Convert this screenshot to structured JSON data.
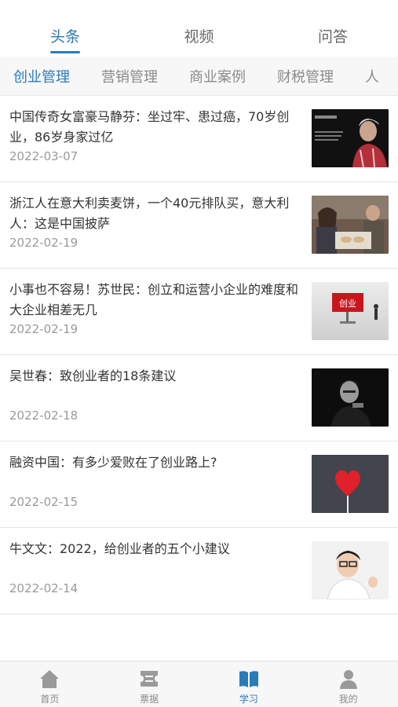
{
  "top_tabs": [
    {
      "label": "头条",
      "active": true
    },
    {
      "label": "视频",
      "active": false
    },
    {
      "label": "问答",
      "active": false
    }
  ],
  "categories": [
    {
      "label": "创业管理",
      "active": true
    },
    {
      "label": "营销管理",
      "active": false
    },
    {
      "label": "商业案例",
      "active": false
    },
    {
      "label": "财税管理",
      "active": false
    },
    {
      "label": "人",
      "active": false
    }
  ],
  "articles": [
    {
      "title": "中国传奇女富豪马静芬：坐过牢、患过癌，70岁创业，86岁身家过亿",
      "date": "2022-03-07",
      "thumb": "elderly-woman-portrait"
    },
    {
      "title": "浙江人在意大利卖麦饼，一个40元排队买，意大利人：这是中国披萨",
      "date": "2022-02-19",
      "thumb": "people-at-table"
    },
    {
      "title": "小事也不容易！苏世民：创立和运营小企业的难度和大企业相差无几",
      "date": "2022-02-19",
      "thumb": "startup-sign",
      "thumb_text": "创业"
    },
    {
      "title": "吴世春：致创业者的18条建议",
      "date": "2022-02-18",
      "thumb": "man-portrait-dark"
    },
    {
      "title": "融资中国：有多少爱败在了创业路上?",
      "date": "2022-02-15",
      "thumb": "red-heart-lollipop"
    },
    {
      "title": "牛文文：2022，给创业者的五个小建议",
      "date": "2022-02-14",
      "thumb": "man-with-glasses"
    }
  ],
  "bottom_nav": [
    {
      "label": "首页",
      "icon": "home-icon",
      "active": false
    },
    {
      "label": "票据",
      "icon": "ticket-icon",
      "active": false
    },
    {
      "label": "学习",
      "icon": "book-icon",
      "active": true
    },
    {
      "label": "我的",
      "icon": "user-icon",
      "active": false
    }
  ],
  "colors": {
    "accent": "#2b7bb9",
    "text": "#333333",
    "muted": "#9a9a9a",
    "category_bg": "#f7f7f7"
  }
}
